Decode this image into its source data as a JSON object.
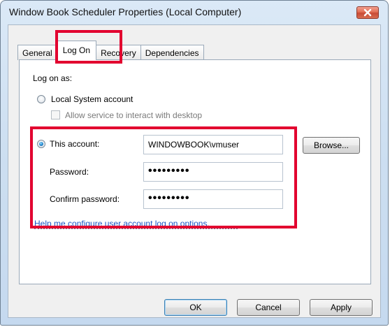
{
  "window": {
    "title": "Window Book Scheduler Properties (Local Computer)"
  },
  "tabs": [
    {
      "label": "General"
    },
    {
      "label": "Log On"
    },
    {
      "label": "Recovery"
    },
    {
      "label": "Dependencies"
    }
  ],
  "logon": {
    "log_on_as_label": "Log on as:",
    "local_system_label": "Local System account",
    "allow_interact_label": "Allow service to interact with desktop",
    "this_account_label": "This account:",
    "account_value": "WINDOWBOOK\\vmuser",
    "browse_label": "Browse...",
    "password_label": "Password:",
    "password_value": "•••••••••",
    "confirm_password_label": "Confirm password:",
    "confirm_password_value": "•••••••••",
    "help_link": "Help me configure user account log on options."
  },
  "buttons": {
    "ok": "OK",
    "cancel": "Cancel",
    "apply": "Apply"
  },
  "state": {
    "selected_tab": "Log On",
    "local_system_selected": false,
    "this_account_selected": true,
    "allow_interact_checked": false
  },
  "icons": {
    "close": "close-icon"
  },
  "colors": {
    "highlight": "#e2002f",
    "window_frame": "#dbe9f7",
    "link": "#1a55c5"
  }
}
